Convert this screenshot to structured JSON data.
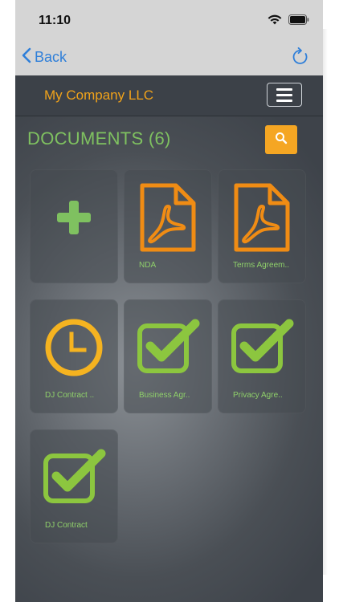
{
  "status_bar": {
    "time": "11:10"
  },
  "nav": {
    "back_label": "Back"
  },
  "header": {
    "company": "My Company LLC"
  },
  "documents": {
    "title": "DOCUMENTS (6)",
    "items": [
      {
        "label": "",
        "icon": "plus-icon"
      },
      {
        "label": "NDA",
        "icon": "pdf-icon"
      },
      {
        "label": "Terms Agreem..",
        "icon": "pdf-icon"
      },
      {
        "label": "DJ Contract ..",
        "icon": "clock-icon"
      },
      {
        "label": "Business Agr..",
        "icon": "checkbox-checked-icon"
      },
      {
        "label": "Privacy Agre..",
        "icon": "checkbox-checked-icon"
      },
      {
        "label": "DJ Contract",
        "icon": "checkbox-checked-icon"
      }
    ]
  },
  "colors": {
    "accent_orange": "#f5a623",
    "accent_green": "#7fc160",
    "header_bg": "#3c4148",
    "ios_blue": "#2f7fd9"
  }
}
